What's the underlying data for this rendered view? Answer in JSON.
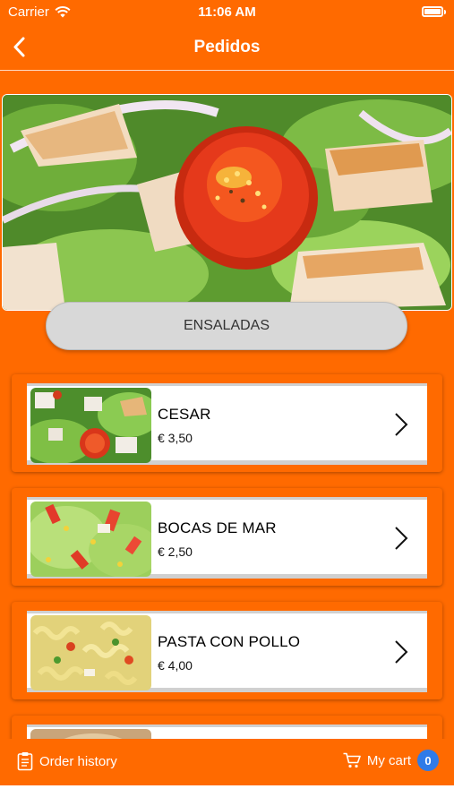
{
  "status_bar": {
    "carrier": "Carrier",
    "time": "11:06 AM"
  },
  "nav": {
    "title": "Pedidos",
    "back_icon": "chevron-left-icon"
  },
  "hero": {
    "image": "salad-photo"
  },
  "category": {
    "label": "ENSALADAS"
  },
  "items": [
    {
      "name": "CESAR",
      "price": "€ 3,50",
      "image": "caesar-salad-photo"
    },
    {
      "name": "BOCAS DE MAR",
      "price": "€ 2,50",
      "image": "crab-salad-photo"
    },
    {
      "name": "PASTA CON POLLO",
      "price": "€ 4,00",
      "image": "pasta-salad-photo"
    },
    {
      "name": "",
      "price": "",
      "image": "partial-item-photo"
    }
  ],
  "bottom_bar": {
    "order_history_label": "Order history",
    "cart_label": "My cart",
    "cart_count": "0"
  },
  "colors": {
    "brand": "#ff6a00",
    "badge": "#2f7be8",
    "card_border": "#d0d0d0"
  }
}
